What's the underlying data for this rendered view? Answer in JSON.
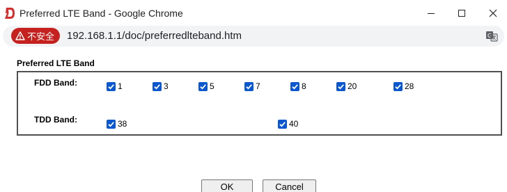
{
  "window": {
    "title": "Preferred LTE Band - Google Chrome",
    "app_logo_letter": "D"
  },
  "address_bar": {
    "security_label": "不安全",
    "url": "192.168.1.1/doc/preferredlteband.htm"
  },
  "page": {
    "heading": "Preferred LTE Band",
    "fdd": {
      "label": "FDD Band:",
      "bands": [
        {
          "label": "1",
          "checked": true
        },
        {
          "label": "3",
          "checked": true
        },
        {
          "label": "5",
          "checked": true
        },
        {
          "label": "7",
          "checked": true
        },
        {
          "label": "8",
          "checked": true
        },
        {
          "label": "20",
          "checked": true
        },
        {
          "label": "28",
          "checked": true
        }
      ]
    },
    "tdd": {
      "label": "TDD Band:",
      "bands": [
        {
          "label": "38",
          "checked": true
        },
        {
          "label": "40",
          "checked": true
        }
      ]
    },
    "buttons": {
      "ok_label": "OK",
      "cancel_label": "Cancel"
    }
  },
  "colors": {
    "checkbox": "#0b57d0",
    "security_chip": "#c5221f",
    "logo": "#d32f2f"
  }
}
